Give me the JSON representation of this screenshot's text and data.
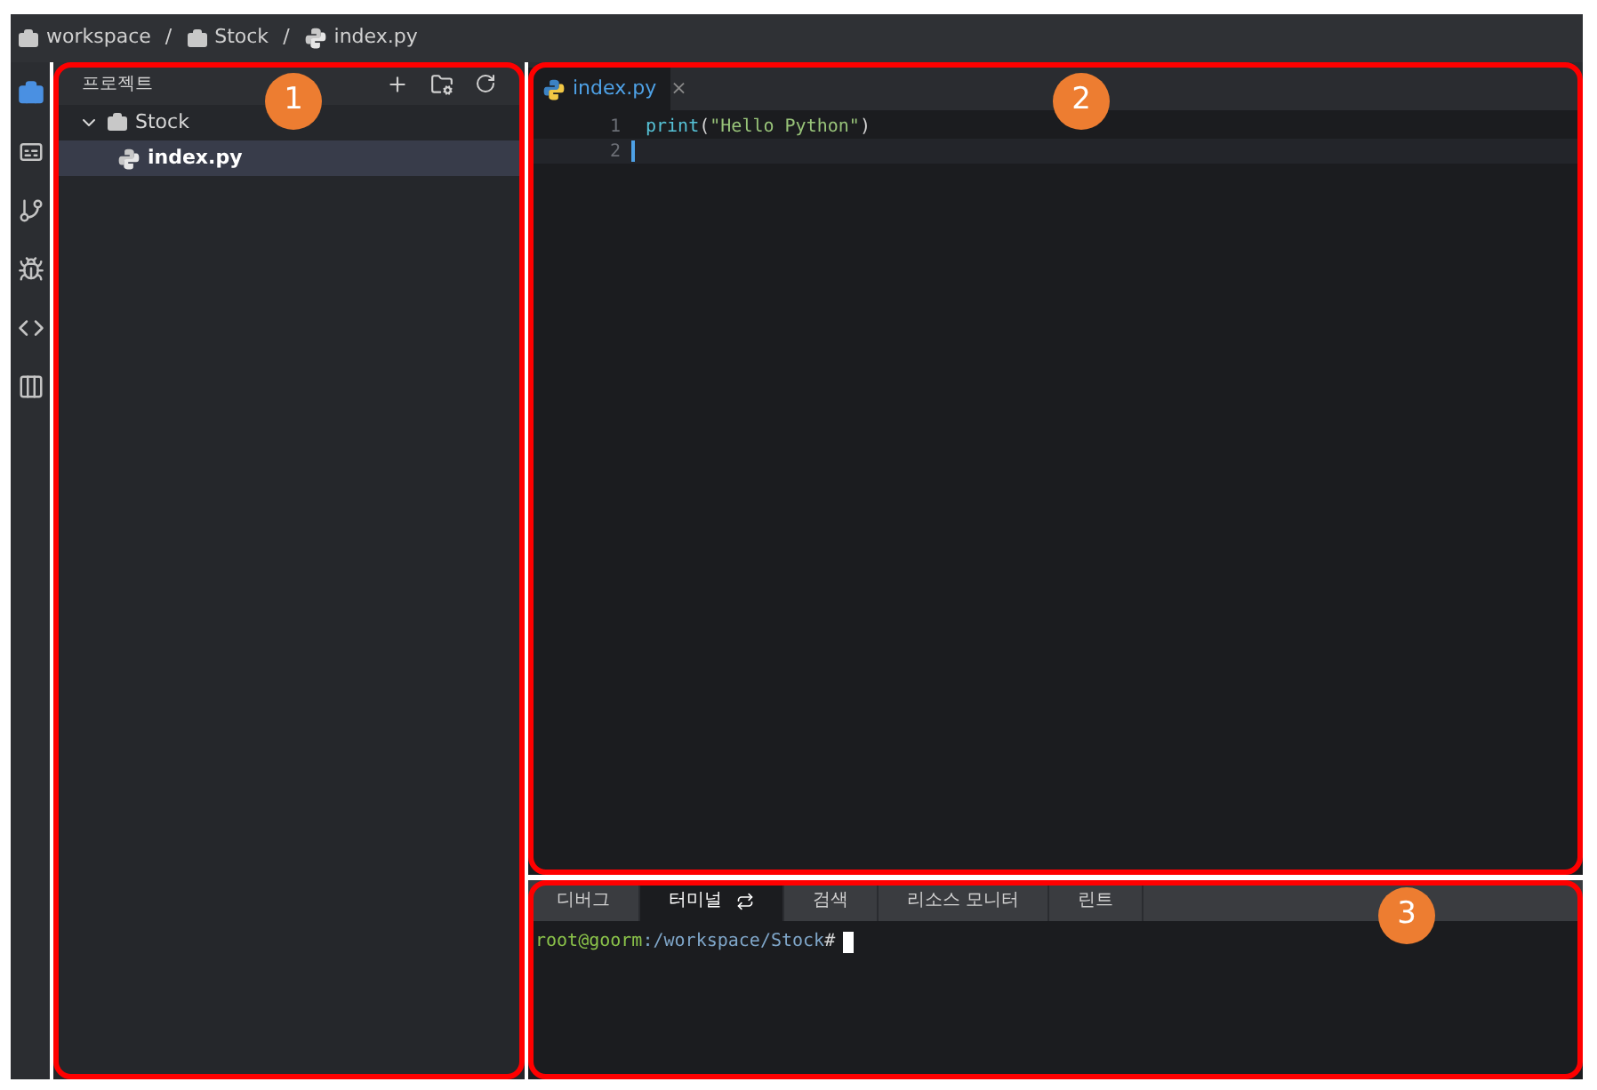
{
  "breadcrumb": [
    {
      "kind": "folder",
      "label": "workspace"
    },
    {
      "kind": "folder",
      "label": "Stock"
    },
    {
      "kind": "python",
      "label": "index.py"
    }
  ],
  "breadcrumb_separator": "/",
  "activity_bar": [
    {
      "kind": "project",
      "selected": true
    },
    {
      "kind": "panel",
      "selected": false
    },
    {
      "kind": "git",
      "selected": false
    },
    {
      "kind": "debug",
      "selected": false
    },
    {
      "kind": "code",
      "selected": false
    },
    {
      "kind": "library",
      "selected": false
    }
  ],
  "explorer": {
    "title": "프로젝트",
    "tree": [
      {
        "kind": "folder",
        "label": "Stock",
        "expanded": true,
        "selected": false,
        "children": [
          {
            "kind": "python",
            "label": "index.py",
            "selected": true
          }
        ]
      }
    ]
  },
  "editor": {
    "tabs": [
      {
        "label": "index.py",
        "close": "×",
        "selected": true
      }
    ],
    "lines": [
      {
        "number": "1",
        "active": false,
        "tokens": [
          {
            "kind": "function",
            "text": "print"
          },
          {
            "kind": "punct",
            "text": "("
          },
          {
            "kind": "string",
            "text": "\"Hello Python\""
          },
          {
            "kind": "punct",
            "text": ")"
          }
        ]
      },
      {
        "number": "2",
        "active": true
      }
    ]
  },
  "bottom_panel": {
    "tabs": [
      {
        "label": "디버그",
        "selected": false,
        "icon": false
      },
      {
        "label": "터미널",
        "selected": true,
        "icon": true
      },
      {
        "label": "검색",
        "selected": false,
        "icon": false
      },
      {
        "label": "리소스 모니터",
        "selected": false,
        "icon": false
      },
      {
        "label": "린트",
        "selected": false,
        "icon": false
      }
    ],
    "prompt": [
      {
        "kind": "user",
        "text": "root@goorm"
      },
      {
        "kind": "path",
        "text": ":/workspace/Stock"
      },
      {
        "kind": "punct",
        "text": "#"
      }
    ]
  },
  "annotations": [
    "1",
    "2",
    "3"
  ]
}
